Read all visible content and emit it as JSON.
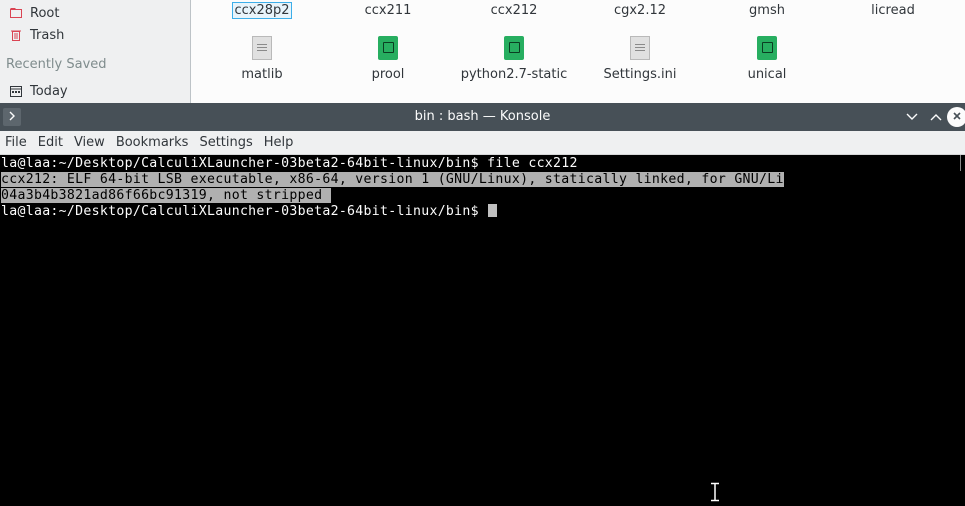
{
  "file_manager": {
    "sidebar": {
      "items": [
        {
          "label": "Root",
          "icon": "root-folder-icon",
          "color": "#da4453"
        },
        {
          "label": "Trash",
          "icon": "trash-icon",
          "color": "#da4453"
        }
      ],
      "recent_heading": "Recently Saved",
      "recent_items": [
        {
          "label": "Today",
          "icon": "calendar-icon"
        }
      ]
    },
    "files_row1": [
      "ccx28p2",
      "ccx211",
      "ccx212",
      "cgx2.12",
      "gmsh",
      "licread"
    ],
    "files_row2": [
      {
        "name": "matlib",
        "icon": "text-file-icon"
      },
      {
        "name": "prool",
        "icon": "executable-file-icon"
      },
      {
        "name": "python2.7-static",
        "icon": "executable-file-icon"
      },
      {
        "name": "Settings.ini",
        "icon": "text-file-icon"
      },
      {
        "name": "unical",
        "icon": "executable-file-icon"
      }
    ],
    "selected_file": "ccx28p2"
  },
  "konsole": {
    "title": "bin : bash — Konsole",
    "menu": [
      "File",
      "Edit",
      "View",
      "Bookmarks",
      "Settings",
      "Help"
    ],
    "lines": [
      "la@laa:~/Desktop/CalculiXLauncher-03beta2-64bit-linux/bin$ file ccx212",
      "ccx212: ELF 64-bit LSB executable, x86-64, version 1 (GNU/Linux), statically linked, for GNU/Li",
      "04a3b4b3821ad86f66bc91319, not stripped ",
      "la@laa:~/Desktop/CalculiXLauncher-03beta2-64bit-linux/bin$ "
    ],
    "colors": {
      "titlebar": "#475057",
      "menubar": "#eff0f1",
      "terminal_bg": "#000000",
      "selection": "#b0b0b0"
    }
  }
}
